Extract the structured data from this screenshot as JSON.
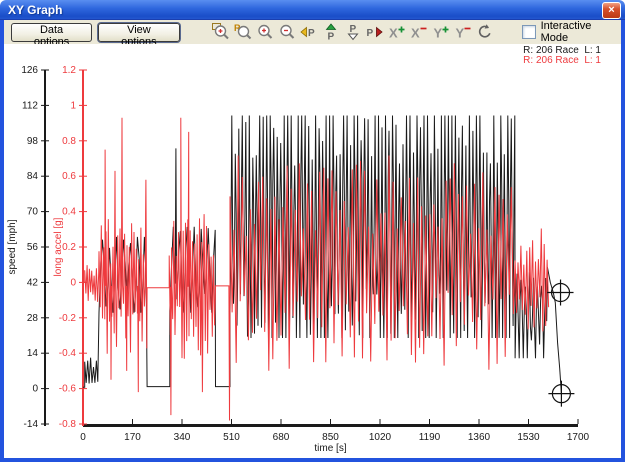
{
  "window": {
    "title": "XY Graph",
    "close_glyph": "×"
  },
  "toolbar": {
    "buttons": [
      {
        "label": "Data options"
      },
      {
        "label": "View options"
      }
    ],
    "icons": [
      "zoom-window-icon",
      "zoom-reset-icon",
      "zoom-in-icon",
      "zoom-out-icon",
      "page-left-icon",
      "page-up-icon",
      "page-down-icon",
      "page-right-icon",
      "x-scale-plus-icon",
      "x-scale-minus-icon",
      "y-scale-plus-icon",
      "y-scale-minus-icon",
      "refresh-icon"
    ],
    "checkbox": {
      "label": "Interactive Mode",
      "checked": false
    }
  },
  "legend": [
    {
      "text": "R: 206 Race  L: 1",
      "color": "#1a1a1a"
    },
    {
      "text": "R: 206 Race  L: 1",
      "color": "#ee3a3e"
    }
  ],
  "chart_data": {
    "type": "line",
    "title": "",
    "xlabel": "time [s]",
    "xlim": [
      0,
      1700
    ],
    "x_ticks": [
      0,
      170,
      340,
      510,
      680,
      850,
      1020,
      1190,
      1360,
      1530,
      1700
    ],
    "axis_color": "#1a1a1a",
    "grid": false,
    "legend_position": "top-right",
    "seed": 11,
    "y_left": {
      "label": "speed [mph]",
      "color": "#1a1a1a",
      "lim": [
        -14,
        126
      ],
      "ticks": [
        126,
        112,
        98,
        84,
        70,
        56,
        42,
        28,
        14,
        0,
        -14
      ]
    },
    "y_right": {
      "label": "long accel [g]",
      "color": "#ee3a3e",
      "lim": [
        -0.8,
        1.2
      ],
      "ticks": [
        1.2,
        1,
        0.8,
        0.6,
        0.4,
        0.2,
        0,
        -0.2,
        -0.4,
        -0.6,
        -0.8
      ]
    },
    "series": [
      {
        "name": "R: 206 Race  L: 1",
        "data_name": "speed-trace",
        "axis": "left",
        "color": "#1a1a1a",
        "phases": [
          {
            "type": "flat",
            "t": [
              0,
              6
            ],
            "v": 0.5
          },
          {
            "type": "noisy",
            "t": [
              6,
              55
            ],
            "min": 0,
            "max": 13,
            "step": 5
          },
          {
            "type": "laps",
            "t": [
              55,
              220
            ],
            "min": 30,
            "max": 60,
            "period": 24
          },
          {
            "type": "flat",
            "t": [
              220,
              298
            ],
            "v": 0.8
          },
          {
            "type": "laps",
            "t": [
              298,
              455
            ],
            "min": 30,
            "max": 64,
            "period": 24,
            "spikes": [
              [
                319,
                95
              ]
            ]
          },
          {
            "type": "flat",
            "t": [
              455,
              505
            ],
            "v": 0.8
          },
          {
            "type": "laps",
            "t": [
              505,
              1484
            ],
            "min": 20,
            "max": 108,
            "period": 12
          },
          {
            "type": "laps",
            "t": [
              1484,
              1595
            ],
            "min": 12,
            "max": 46,
            "period": 14
          },
          {
            "type": "points",
            "pts": [
              [
                1595,
                48
              ],
              [
                1605,
                42
              ],
              [
                1615,
                38
              ],
              [
                1622,
                34
              ],
              [
                1630,
                18
              ],
              [
                1637,
                8
              ],
              [
                1643,
                -2
              ]
            ]
          }
        ]
      },
      {
        "name": "R: 206 Race  L: 1",
        "data_name": "accel-trace",
        "axis": "right",
        "color": "#ee3a3e",
        "phases": [
          {
            "type": "flat",
            "t": [
              0,
              6
            ],
            "v": 0
          },
          {
            "type": "noisy",
            "t": [
              6,
              55
            ],
            "min": -0.12,
            "max": 0.12,
            "step": 4
          },
          {
            "type": "noisy",
            "t": [
              55,
              220
            ],
            "min": -0.42,
            "max": 0.38,
            "step": 4,
            "spikes": [
              [
                76,
                0.75
              ],
              [
                96,
                -0.55
              ],
              [
                110,
                0.63
              ],
              [
                134,
                0.93
              ],
              [
                150,
                -0.5
              ],
              [
                190,
                -0.62
              ],
              [
                216,
                0.58
              ]
            ]
          },
          {
            "type": "flat",
            "t": [
              220,
              296
            ],
            "v": -0.03
          },
          {
            "type": "noisy",
            "t": [
              296,
              455
            ],
            "min": -0.45,
            "max": 0.4,
            "step": 4,
            "spikes": [
              [
                302,
                -0.75
              ],
              [
                336,
                0.93
              ],
              [
                363,
                0.85
              ],
              [
                410,
                -0.62
              ]
            ]
          },
          {
            "type": "flat",
            "t": [
              455,
              505
            ],
            "v": -0.02,
            "spikes": [
              [
                503,
                -0.78
              ]
            ]
          },
          {
            "type": "noisy",
            "t": [
              505,
              1484
            ],
            "min": -0.5,
            "max": 0.72,
            "step": 7
          },
          {
            "type": "noisy",
            "t": [
              1484,
              1600
            ],
            "min": -0.3,
            "max": 0.32,
            "step": 5
          }
        ]
      }
    ],
    "cursors": [
      {
        "t": 1640,
        "v": 38
      },
      {
        "t": 1643,
        "v": -2
      }
    ]
  }
}
